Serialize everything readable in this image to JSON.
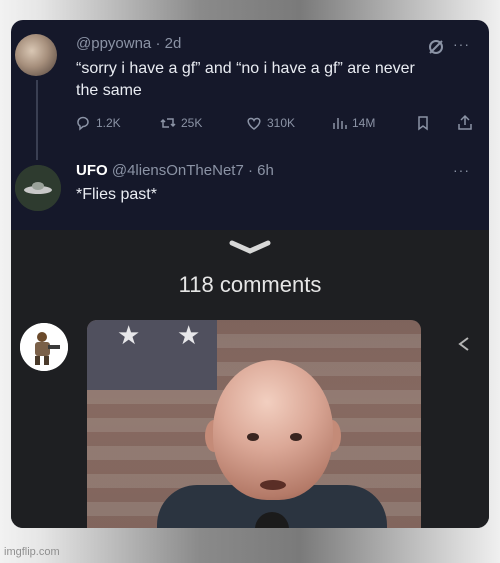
{
  "tweet1": {
    "handle": "@ppyowna",
    "time": "· 2d",
    "text_line1": "“sorry i have a gf” and “no i have a gf” are never",
    "text_line2": "the same",
    "stats": {
      "replies": "1.2K",
      "retweets": "25K",
      "likes": "310K",
      "views": "14M"
    },
    "more_label": "···"
  },
  "tweet2": {
    "name": "UFO",
    "handle": "@4liensOnTheNet7",
    "time": "· 6h",
    "text": "*Flies past*",
    "more_label": "···"
  },
  "comments": {
    "title": "118 comments"
  },
  "watermark": "imgflip.com",
  "colors": {
    "background": "#15182a",
    "text_primary": "#e9ecf2",
    "text_secondary": "#8b93a5",
    "comments_panel": "#1e1f22"
  }
}
